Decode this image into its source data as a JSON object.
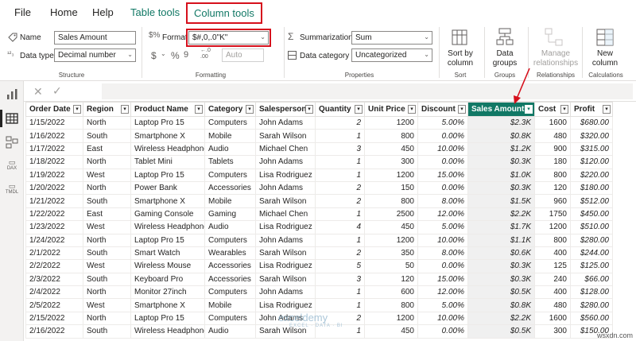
{
  "menu": {
    "file": "File",
    "home": "Home",
    "help": "Help",
    "table_tools": "Table tools",
    "column_tools": "Column tools"
  },
  "ribbon": {
    "structure": {
      "group_label": "Structure",
      "name_label": "Name",
      "name_value": "Sales Amount",
      "datatype_label": "Data type",
      "datatype_value": "Decimal number"
    },
    "formatting": {
      "group_label": "Formatting",
      "format_label": "Format",
      "format_value": "$#,0,.0\"K\"",
      "currency_glyph": "$",
      "percent_glyph": "%",
      "comma_glyph": "9",
      "decimals_value": "Auto"
    },
    "properties": {
      "group_label": "Properties",
      "summarization_label": "Summarization",
      "summarization_value": "Sum",
      "category_label": "Data category",
      "category_value": "Uncategorized"
    },
    "sort": {
      "group_label": "Sort",
      "button_label": "Sort by column"
    },
    "groups": {
      "group_label": "Groups",
      "button_label": "Data groups"
    },
    "relationships": {
      "group_label": "Relationships",
      "button_label": "Manage relationships"
    },
    "calculations": {
      "group_label": "Calculations",
      "button_label": "New column"
    }
  },
  "rail": {
    "dax_label": "DAX",
    "tmdl_label": "TMDL"
  },
  "table": {
    "columns": [
      "Order Date",
      "Region",
      "Product Name",
      "Category",
      "Salesperson",
      "Quantity",
      "Unit Price",
      "Discount",
      "Sales Amount",
      "Cost",
      "Profit"
    ],
    "rows": [
      [
        "1/15/2022",
        "North",
        "Laptop Pro 15",
        "Computers",
        "John Adams",
        "2",
        "1200",
        "5.00%",
        "$2.3K",
        "1600",
        "$680.00"
      ],
      [
        "1/16/2022",
        "South",
        "Smartphone X",
        "Mobile",
        "Sarah Wilson",
        "1",
        "800",
        "0.00%",
        "$0.8K",
        "480",
        "$320.00"
      ],
      [
        "1/17/2022",
        "East",
        "Wireless Headphones",
        "Audio",
        "Michael Chen",
        "3",
        "450",
        "10.00%",
        "$1.2K",
        "900",
        "$315.00"
      ],
      [
        "1/18/2022",
        "North",
        "Tablet Mini",
        "Tablets",
        "John Adams",
        "1",
        "300",
        "0.00%",
        "$0.3K",
        "180",
        "$120.00"
      ],
      [
        "1/19/2022",
        "West",
        "Laptop Pro 15",
        "Computers",
        "Lisa Rodriguez",
        "1",
        "1200",
        "15.00%",
        "$1.0K",
        "800",
        "$220.00"
      ],
      [
        "1/20/2022",
        "North",
        "Power Bank",
        "Accessories",
        "John Adams",
        "2",
        "150",
        "0.00%",
        "$0.3K",
        "120",
        "$180.00"
      ],
      [
        "1/21/2022",
        "South",
        "Smartphone X",
        "Mobile",
        "Sarah Wilson",
        "2",
        "800",
        "8.00%",
        "$1.5K",
        "960",
        "$512.00"
      ],
      [
        "1/22/2022",
        "East",
        "Gaming Console",
        "Gaming",
        "Michael Chen",
        "1",
        "2500",
        "12.00%",
        "$2.2K",
        "1750",
        "$450.00"
      ],
      [
        "1/23/2022",
        "West",
        "Wireless Headphones",
        "Audio",
        "Lisa Rodriguez",
        "4",
        "450",
        "5.00%",
        "$1.7K",
        "1200",
        "$510.00"
      ],
      [
        "1/24/2022",
        "North",
        "Laptop Pro 15",
        "Computers",
        "John Adams",
        "1",
        "1200",
        "10.00%",
        "$1.1K",
        "800",
        "$280.00"
      ],
      [
        "2/1/2022",
        "South",
        "Smart Watch",
        "Wearables",
        "Sarah Wilson",
        "2",
        "350",
        "8.00%",
        "$0.6K",
        "400",
        "$244.00"
      ],
      [
        "2/2/2022",
        "West",
        "Wireless Mouse",
        "Accessories",
        "Lisa Rodriguez",
        "5",
        "50",
        "0.00%",
        "$0.3K",
        "125",
        "$125.00"
      ],
      [
        "2/3/2022",
        "South",
        "Keyboard Pro",
        "Accessories",
        "Sarah Wilson",
        "3",
        "120",
        "15.00%",
        "$0.3K",
        "240",
        "$66.00"
      ],
      [
        "2/4/2022",
        "North",
        "Monitor 27inch",
        "Computers",
        "John Adams",
        "1",
        "600",
        "12.00%",
        "$0.5K",
        "400",
        "$128.00"
      ],
      [
        "2/5/2022",
        "West",
        "Smartphone X",
        "Mobile",
        "Lisa Rodriguez",
        "1",
        "800",
        "5.00%",
        "$0.8K",
        "480",
        "$280.00"
      ],
      [
        "2/15/2022",
        "North",
        "Laptop Pro 15",
        "Computers",
        "John Adams",
        "2",
        "1200",
        "10.00%",
        "$2.2K",
        "1600",
        "$560.00"
      ],
      [
        "2/16/2022",
        "South",
        "Wireless Headphones",
        "Audio",
        "Sarah Wilson",
        "1",
        "450",
        "0.00%",
        "$0.5K",
        "300",
        "$150.00"
      ]
    ]
  },
  "watermark": {
    "brand": "exceldemy",
    "tagline": "EXCEL · DATA · BI"
  },
  "corner_text": "wsxdn.com",
  "colors": {
    "accent": "#117865",
    "highlight_red": "#d6101c"
  }
}
